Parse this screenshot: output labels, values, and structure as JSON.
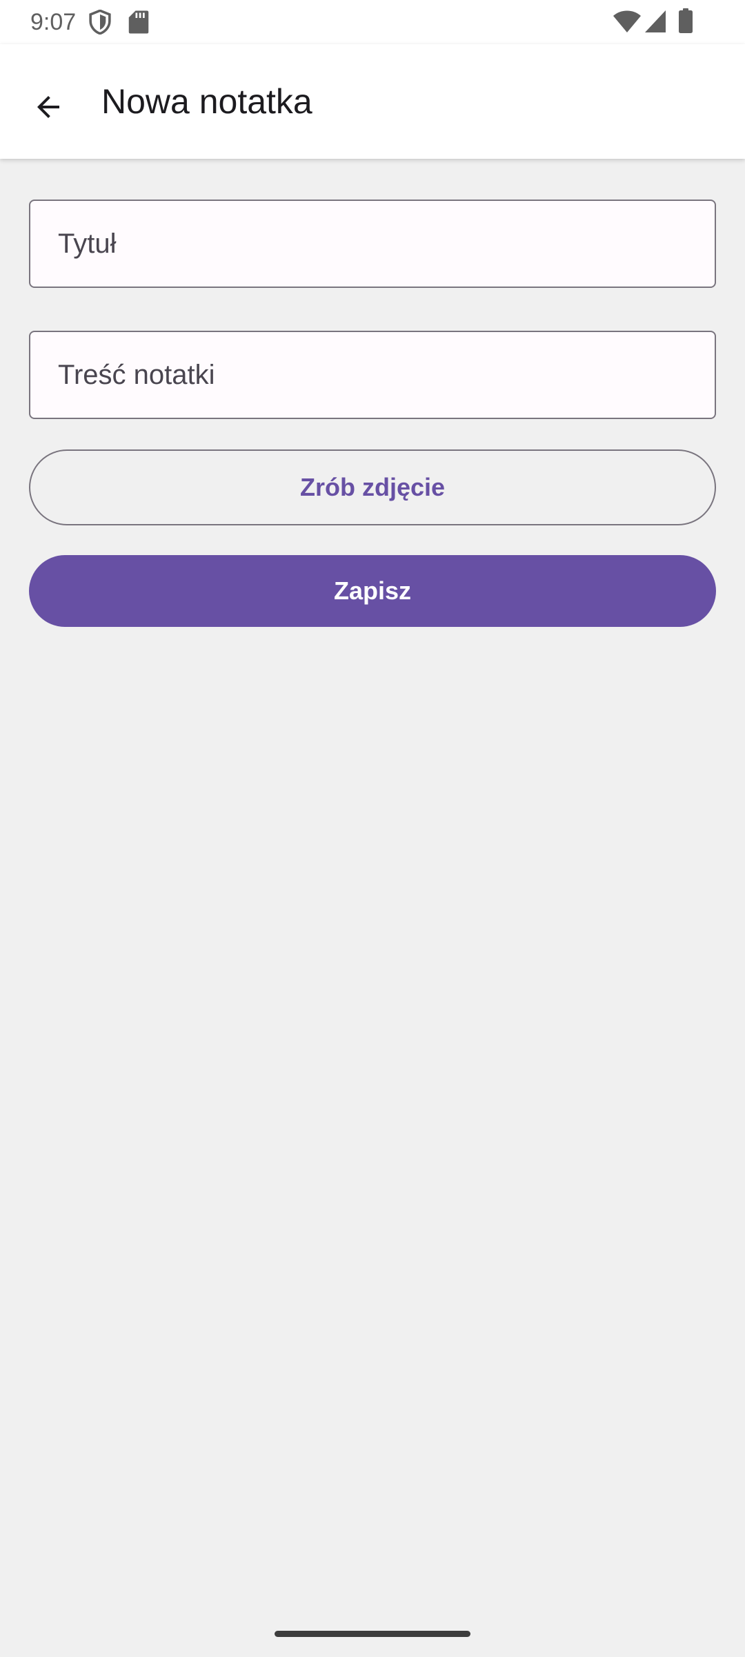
{
  "status_bar": {
    "time": "9:07",
    "icons": [
      "shield-icon",
      "sd-card-icon",
      "wifi-icon",
      "cellular-signal-icon",
      "battery-icon"
    ]
  },
  "app_bar": {
    "back_icon": "arrow-back-icon",
    "title": "Nowa notatka"
  },
  "form": {
    "title_field": {
      "placeholder": "Tytuł",
      "value": ""
    },
    "content_field": {
      "placeholder": "Treść notatki",
      "value": ""
    },
    "photo_button_label": "Zrób zdjęcie",
    "save_button_label": "Zapisz"
  },
  "colors": {
    "primary": "#6750a4",
    "background": "#f0f0f0",
    "surface": "#ffffff",
    "field_background": "#fffbfe",
    "outline": "#79747e"
  }
}
